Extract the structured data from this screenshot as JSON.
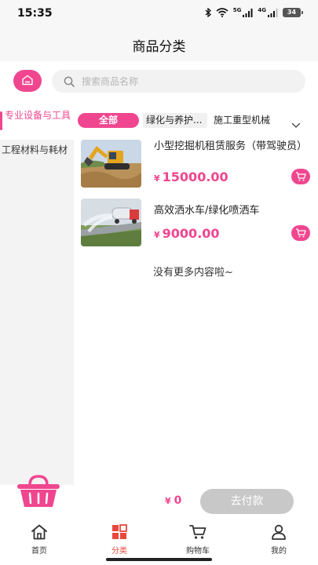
{
  "status_bar": {
    "time": "15:35",
    "signal_1": "5G",
    "signal_2": "4G",
    "battery": "34"
  },
  "header": {
    "title": "商品分类"
  },
  "search": {
    "placeholder": "搜索商品名称"
  },
  "sidebar": {
    "items": [
      {
        "label": "专业设备与工具",
        "active": true
      },
      {
        "label": "工程材料与耗材",
        "active": false
      }
    ]
  },
  "subcategories": {
    "all_label": "全部",
    "items": [
      "绿化与养护...",
      "施工重型机械"
    ]
  },
  "products": [
    {
      "name": "小型挖掘机租赁服务（带驾驶员）",
      "currency": "¥",
      "price": "15000.00",
      "image": "excavator-photo"
    },
    {
      "name": "高效洒水车/绿化喷洒车",
      "currency": "¥",
      "price": "9000.00",
      "image": "sprinkler-truck-photo"
    }
  ],
  "list_end_text": "没有更多内容啦~",
  "cart": {
    "currency": "¥",
    "total": "0",
    "checkout_label": "去付款"
  },
  "tabbar": {
    "items": [
      {
        "label": "首页",
        "icon": "home-icon"
      },
      {
        "label": "分类",
        "icon": "category-icon",
        "active": true
      },
      {
        "label": "购物车",
        "icon": "cart-icon"
      },
      {
        "label": "我的",
        "icon": "user-icon"
      }
    ]
  },
  "colors": {
    "accent": "#f0468f",
    "tab_active": "#e8473b",
    "disabled_button": "#c8c8c8"
  }
}
